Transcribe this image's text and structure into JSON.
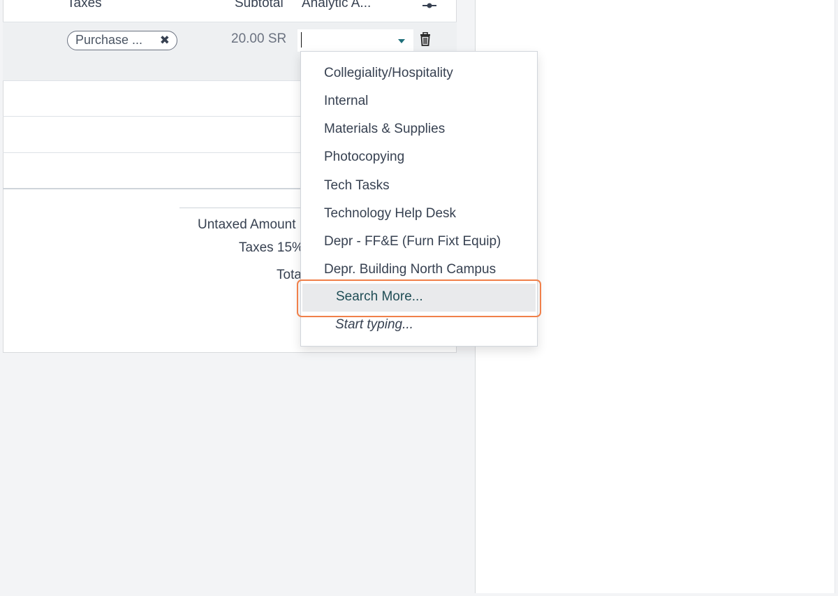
{
  "table": {
    "headers": {
      "taxes": "Taxes",
      "subtotal": "Subtotal",
      "analytic": "Analytic A..."
    },
    "line": {
      "tax_tag": "Purchase ...",
      "subtotal": "20.00 SR",
      "analytic_value": ""
    }
  },
  "totals": {
    "untaxed_label": "Untaxed Amount",
    "taxes_label": "Taxes 15%",
    "total_label": "Total"
  },
  "dropdown": {
    "options": [
      "Collegiality/Hospitality",
      "Internal",
      "Materials & Supplies",
      "Photocopying",
      "Tech Tasks",
      "Technology Help Desk",
      "Depr - FF&E (Furn Fixt Equip)",
      "Depr. Building North Campus"
    ],
    "search_more": "Search More...",
    "hint": "Start typing..."
  },
  "colors": {
    "highlight": "#f0804a",
    "accent": "#1f6f7a"
  },
  "icons": {
    "remove": "close-icon",
    "delete": "trash-icon",
    "columns": "column-toggle-icon",
    "dropdown": "caret-down-icon"
  }
}
